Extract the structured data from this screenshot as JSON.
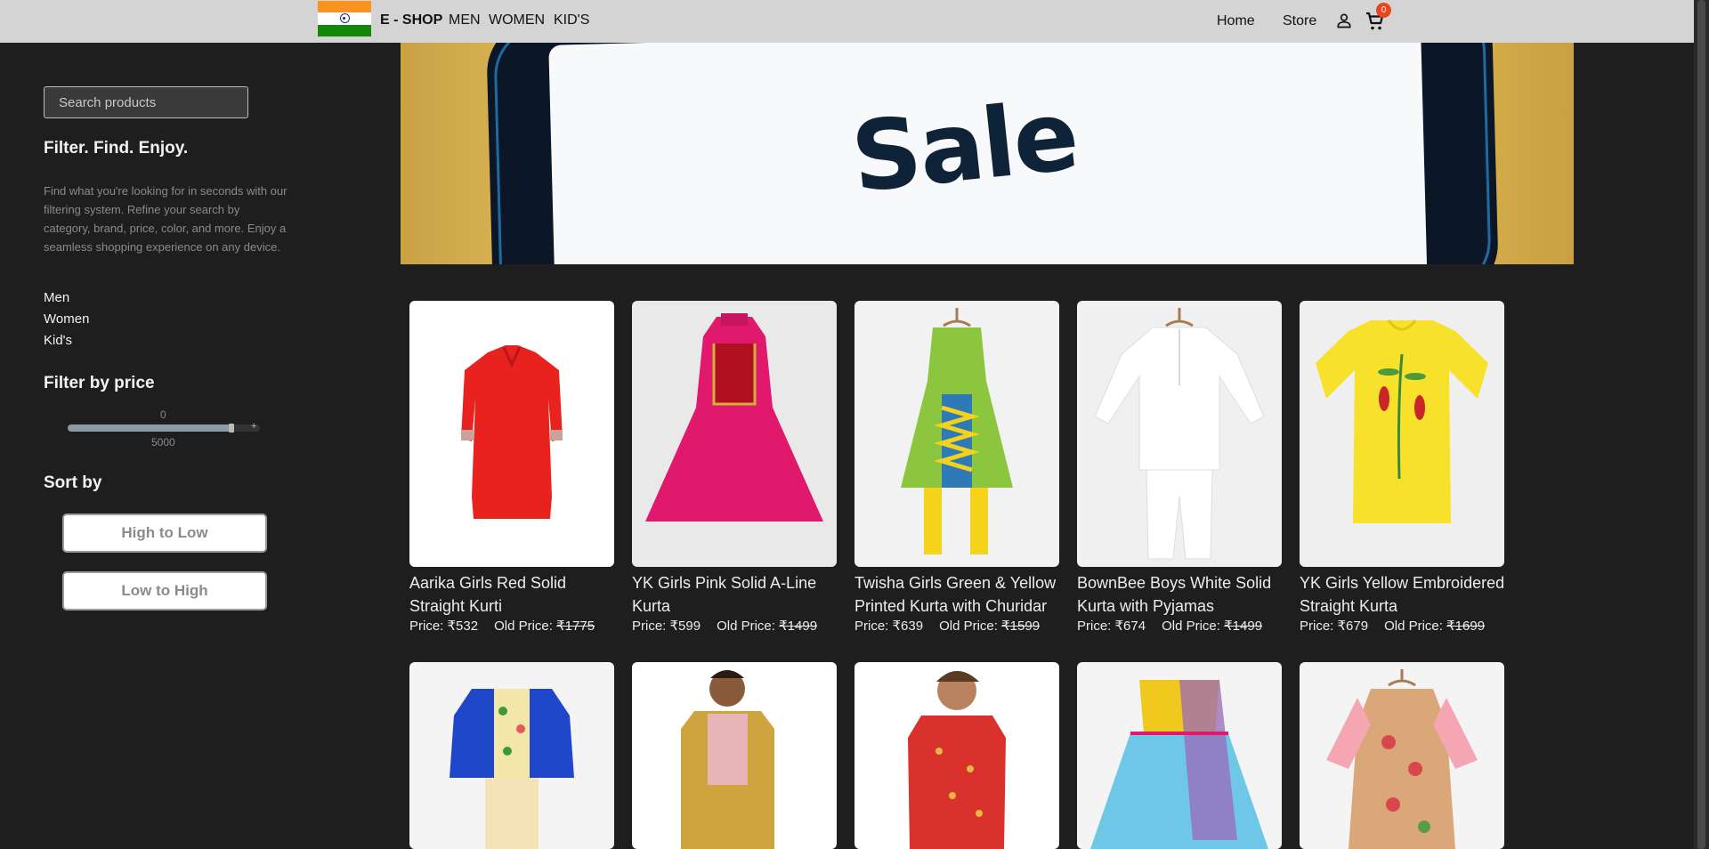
{
  "navbar": {
    "brand": "E - SHOP",
    "links": [
      "MEN",
      "WOMEN",
      "KID'S"
    ],
    "home": "Home",
    "store": "Store",
    "cart_count": "0"
  },
  "sidebar": {
    "search_placeholder": "Search products",
    "tagline": "Filter. Find. Enjoy.",
    "description": "Find what you're looking for in seconds with our filtering system. Refine your search by category, brand, price, color, and more. Enjoy a seamless shopping experience on any device.",
    "categories": [
      "Men",
      "Women",
      "Kid's"
    ],
    "price_heading": "Filter by price",
    "price_min": "0",
    "price_max": "5000",
    "price_level": 0.92,
    "sort_heading": "Sort by",
    "sort_high_low": "High to Low",
    "sort_low_high": "Low to High"
  },
  "banner": {
    "text": "Sale"
  },
  "products": [
    {
      "title": "Aarika Girls Red Solid Straight Kurti",
      "price_label": "Price: ₹532",
      "old_label": "Old Price: ",
      "old_price": "₹1775"
    },
    {
      "title": "YK Girls Pink Solid A-Line Kurta",
      "price_label": "Price: ₹599",
      "old_label": "Old Price: ",
      "old_price": "₹1499"
    },
    {
      "title": "Twisha Girls Green & Yellow Printed Kurta with Churidar",
      "price_label": "Price: ₹639",
      "old_label": "Old Price: ",
      "old_price": "₹1599"
    },
    {
      "title": "BownBee Boys White Solid Kurta with Pyjamas",
      "price_label": "Price: ₹674",
      "old_label": "Old Price: ",
      "old_price": "₹1499"
    },
    {
      "title": "YK Girls Yellow Embroidered Straight Kurta",
      "price_label": "Price: ₹679",
      "old_label": "Old Price: ",
      "old_price": "₹1699"
    }
  ]
}
